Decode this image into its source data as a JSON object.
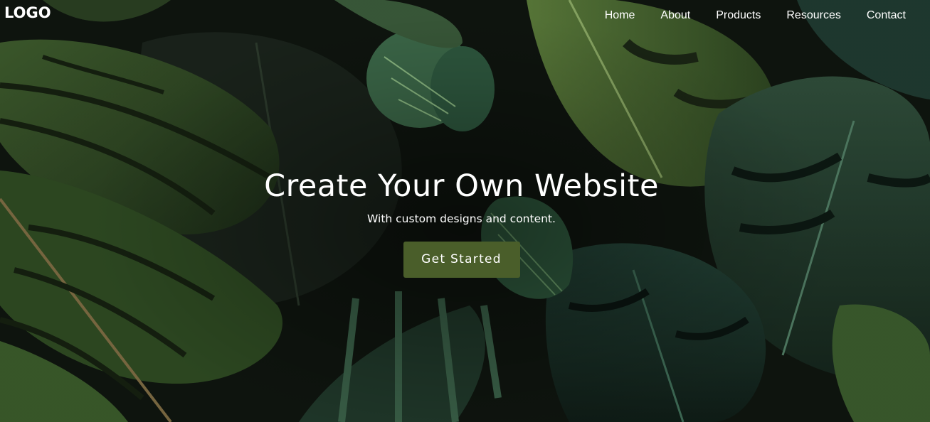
{
  "header": {
    "logo": "LOGO",
    "nav": [
      {
        "label": "Home"
      },
      {
        "label": "About"
      },
      {
        "label": "Products"
      },
      {
        "label": "Resources"
      },
      {
        "label": "Contact"
      }
    ]
  },
  "hero": {
    "title": "Create Your Own Website",
    "subtitle": "With custom designs and content.",
    "cta_label": "Get Started",
    "cta_color": "#4a5e2a",
    "background": "dark tropical leaves photo"
  }
}
